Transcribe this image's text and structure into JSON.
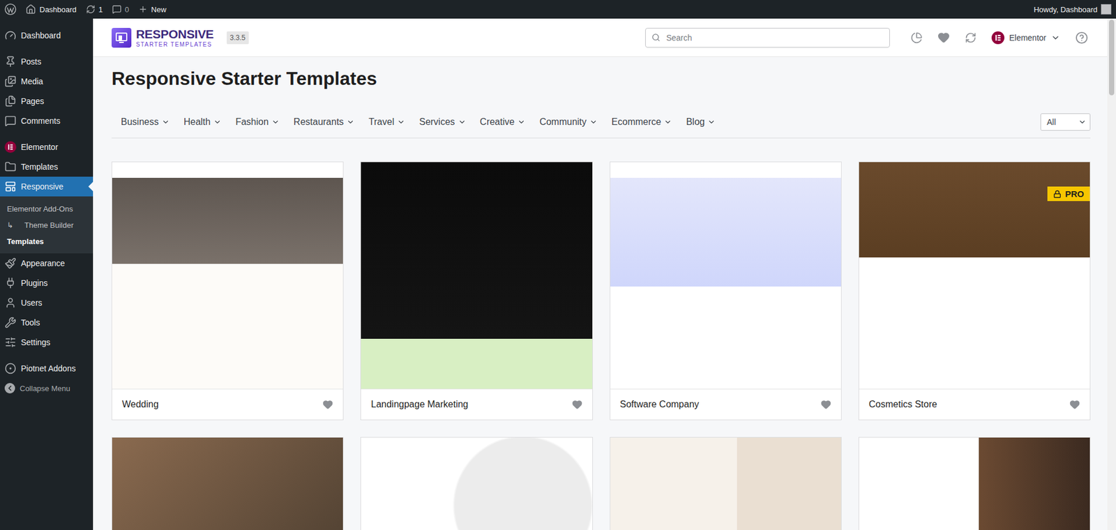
{
  "admin_bar": {
    "site": "Dashboard",
    "updates": "1",
    "comments": "0",
    "new": "New",
    "greeting": "Howdy, Dashboard"
  },
  "sidebar": {
    "items": [
      {
        "label": "Dashboard",
        "selected": false
      },
      {
        "label": "Posts",
        "selected": false
      },
      {
        "label": "Media",
        "selected": false
      },
      {
        "label": "Pages",
        "selected": false
      },
      {
        "label": "Comments",
        "selected": false
      },
      {
        "label": "Elementor",
        "selected": false
      },
      {
        "label": "Templates",
        "selected": false
      },
      {
        "label": "Responsive",
        "selected": true,
        "submenu": [
          {
            "label": "Elementor Add-Ons",
            "prefix": "",
            "selected": false
          },
          {
            "label": "Theme Builder",
            "prefix": "↳",
            "selected": false
          },
          {
            "label": "Templates",
            "prefix": "",
            "selected": true
          }
        ]
      },
      {
        "label": "Appearance",
        "selected": false
      },
      {
        "label": "Plugins",
        "selected": false
      },
      {
        "label": "Users",
        "selected": false
      },
      {
        "label": "Tools",
        "selected": false
      },
      {
        "label": "Settings",
        "selected": false
      },
      {
        "label": "Piotnet Addons",
        "selected": false
      }
    ],
    "collapse": "Collapse Menu"
  },
  "header": {
    "brand_top": "RESPONSIVE",
    "brand_bottom": "STARTER TEMPLATES",
    "version": "3.3.5",
    "search_placeholder": "Search",
    "builder": "Elementor"
  },
  "page_title": "Responsive Starter Templates",
  "categories": [
    "Business",
    "Health",
    "Fashion",
    "Restaurants",
    "Travel",
    "Services",
    "Creative",
    "Community",
    "Ecommerce",
    "Blog"
  ],
  "filter": {
    "value": "All"
  },
  "cards": [
    {
      "title": "Wedding",
      "pro": false,
      "favorite": false
    },
    {
      "title": "Landingpage Marketing",
      "pro": false,
      "favorite": false
    },
    {
      "title": "Software Company",
      "pro": false,
      "favorite": false
    },
    {
      "title": "Cosmetics Store",
      "pro": true,
      "pro_label": "PRO",
      "favorite": false
    },
    {
      "pro": false,
      "favorite": false
    },
    {
      "pro": false,
      "favorite": false
    },
    {
      "pro": false,
      "favorite": false
    },
    {
      "pro": false,
      "favorite": false
    }
  ]
}
